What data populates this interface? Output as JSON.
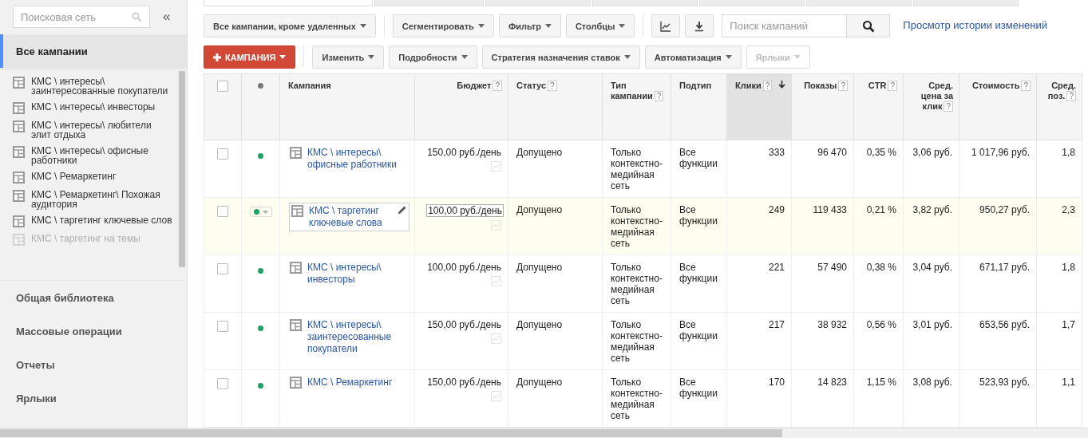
{
  "top_tabs": [
    {
      "selected": true
    },
    {
      "selected": false
    },
    {
      "selected": false
    },
    {
      "selected": false
    },
    {
      "selected": false
    },
    {
      "selected": false
    },
    {
      "selected": false
    }
  ],
  "sidebar": {
    "search": {
      "placeholder": "Поисковая сеть"
    },
    "collapse": "«",
    "all_campaigns": {
      "label": "Все кампании",
      "selected": true
    },
    "campaigns": [
      {
        "label": "КМС \\ интересы\\ заинтересованные покупатели",
        "faded": false
      },
      {
        "label": "КМС \\ интересы\\ инвесторы",
        "faded": false
      },
      {
        "label": "КМС \\ интересы\\ любители элит отдыха",
        "faded": false
      },
      {
        "label": "КМС \\ интересы\\ офисные работники",
        "faded": false
      },
      {
        "label": "КМС \\ Ремаркетинг",
        "faded": false
      },
      {
        "label": "КМС \\ Ремаркетинг\\ Похожая аудитория",
        "faded": false
      },
      {
        "label": "КМС \\ таргетинг ключевые слов",
        "faded": false
      },
      {
        "label": "КМС \\ таргетинг на темы",
        "faded": true
      }
    ],
    "nav": [
      "Общая библиотека",
      "Массовые операции",
      "Отчеты",
      "Ярлыки"
    ]
  },
  "toolbar1": {
    "dropdowns": [
      "Все кампании, кроме удаленных",
      "Сегментировать",
      "Фильтр",
      "Столбцы"
    ],
    "icon_buttons": [
      {
        "kind": "chart"
      },
      {
        "kind": "download"
      }
    ],
    "search": {
      "placeholder": "Поиск кампаний"
    },
    "link": "Просмотр истории изменений"
  },
  "toolbar2": [
    {
      "label": "КАМПАНИЯ",
      "kind": "primary",
      "disabled": false
    },
    {
      "label": "Изменить",
      "kind": "normal",
      "disabled": false
    },
    {
      "label": "Подробности",
      "kind": "normal",
      "disabled": false
    },
    {
      "label": "Стратегия назначения ставок",
      "kind": "normal",
      "disabled": false
    },
    {
      "label": "Автоматизация",
      "kind": "normal",
      "disabled": false
    },
    {
      "label": "Ярлыки",
      "kind": "normal",
      "disabled": true
    }
  ],
  "table": {
    "header_checked": false,
    "columns": [
      {
        "label": "Кампания",
        "kind": "text",
        "sorted": false
      },
      {
        "label": "Бюджет",
        "kind": "number",
        "help": "?",
        "sorted": false
      },
      {
        "label": "Статус",
        "kind": "text",
        "help": "?",
        "sorted": false
      },
      {
        "label": "Тип кампании",
        "kind": "text",
        "help": "?",
        "sorted": false
      },
      {
        "label": "Подтип",
        "kind": "text",
        "sorted": false
      },
      {
        "label": "Клики",
        "kind": "number",
        "help": "?",
        "sorted": true
      },
      {
        "label": "Показы",
        "kind": "number",
        "help": "?",
        "sorted": false
      },
      {
        "label": "CTR",
        "kind": "number",
        "help": "?",
        "sorted": false
      },
      {
        "label": "Сред. цена за клик",
        "kind": "number",
        "help": "?",
        "sorted": false
      },
      {
        "label": "Стоимость",
        "kind": "number",
        "help": "?",
        "sorted": false
      },
      {
        "label": "Сред. поз.",
        "kind": "number",
        "help": "?",
        "sorted": false
      }
    ],
    "rows": [
      {
        "checked": false,
        "selected": false,
        "cells": [
          "КМС \\ интересы\\ офисные работники",
          "150,00 руб./день",
          "Допущено",
          "Только контекстно-медийная сеть",
          "Все функции",
          "333",
          "96 470",
          "0,35 %",
          "3,06 руб.",
          "1 017,96 руб.",
          "1,8"
        ]
      },
      {
        "checked": false,
        "selected": true,
        "cells": [
          "КМС \\ таргетинг ключевые слова",
          "100,00 руб./день",
          "Допущено",
          "Только контекстно-медийная сеть",
          "Все функции",
          "249",
          "119 433",
          "0,21 %",
          "3,82 руб.",
          "950,27 руб.",
          "2,3"
        ]
      },
      {
        "checked": false,
        "selected": false,
        "cells": [
          "КМС \\ интересы\\ инвесторы",
          "100,00 руб./день",
          "Допущено",
          "Только контекстно-медийная сеть",
          "Все функции",
          "221",
          "57 490",
          "0,38 %",
          "3,04 руб.",
          "671,17 руб.",
          "1,8"
        ]
      },
      {
        "checked": false,
        "selected": false,
        "cells": [
          "КМС \\ интересы\\ заинтересованные покупатели",
          "150,00 руб./день",
          "Допущено",
          "Только контекстно-медийная сеть",
          "Все функции",
          "217",
          "38 932",
          "0,56 %",
          "3,01 руб.",
          "653,56 руб.",
          "1,7"
        ]
      },
      {
        "checked": false,
        "selected": false,
        "cells": [
          "КМС \\ Ремаркетинг",
          "150,00 руб./день",
          "Допущено",
          "Только контекстно-медийная сеть",
          "Все функции",
          "170",
          "14 823",
          "1,15 %",
          "3,08 руб.",
          "523,93 руб.",
          "1,1"
        ]
      }
    ]
  }
}
